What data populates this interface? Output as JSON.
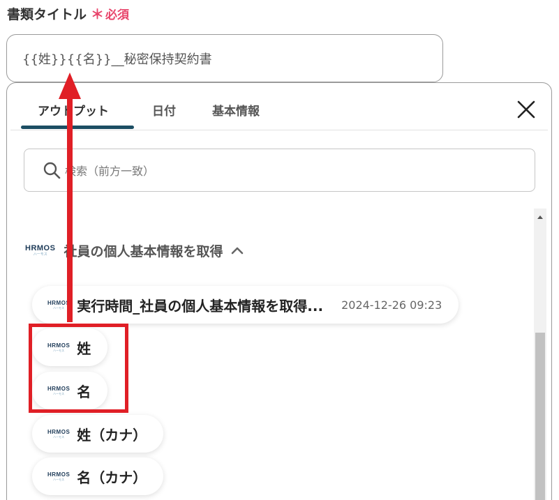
{
  "field": {
    "label": "書類タイトル",
    "required_mark": "＊",
    "required_text": "必須",
    "value": "{{姓}}{{名}}__秘密保持契約書"
  },
  "panel": {
    "tabs": [
      {
        "label": "アウトプット",
        "active": true
      },
      {
        "label": "日付",
        "active": false
      },
      {
        "label": "基本情報",
        "active": false
      }
    ],
    "search": {
      "placeholder": "検索（前方一致）"
    },
    "logo_text": "HRMOS",
    "logo_sub": "ハーモス",
    "group": {
      "title": "社員の個人基本情報を取得",
      "items": [
        {
          "label": "実行時間_社員の個人基本情報を取得...",
          "value": "2024-12-26 09:23"
        },
        {
          "label": "姓"
        },
        {
          "label": "名"
        },
        {
          "label": "姓（カナ）"
        },
        {
          "label": "名（カナ）"
        }
      ]
    }
  },
  "colors": {
    "accent": "#1c4e63",
    "required": "#e8456b",
    "annotation": "#e01f26"
  },
  "icons": [
    "search-icon",
    "close-icon",
    "chevron-up-icon",
    "hrmos-logo-icon",
    "scroll-up-arrow-icon"
  ]
}
